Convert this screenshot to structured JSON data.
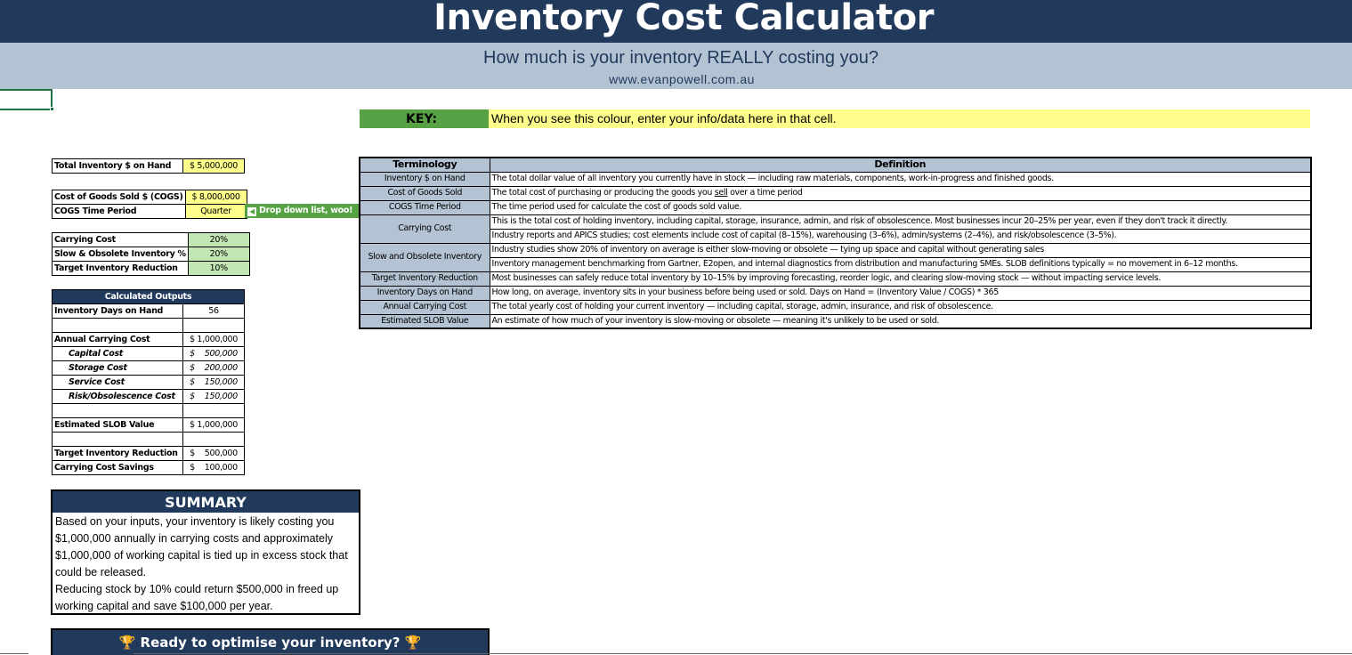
{
  "header": {
    "title": "Inventory Cost Calculator",
    "subtitle": "How much is your inventory REALLY costing you?",
    "website": "www.evanpowell.com.au"
  },
  "key": {
    "label": "KEY:",
    "text": "When you see this colour, enter your info/data here in that cell."
  },
  "inputs": {
    "total_inventory_label": "Total Inventory $ on Hand",
    "total_inventory_value": "$ 5,000,000",
    "cogs_label": "Cost of Goods Sold $ (COGS)",
    "cogs_value": "$ 8,000,000",
    "cogs_period_label": "COGS Time Period",
    "cogs_period_value": "Quarter",
    "dropdown_note": "Drop down list, woo!",
    "carrying_cost_label": "Carrying Cost",
    "carrying_cost_value": "20%",
    "slob_label": "Slow & Obsolete Inventory  %",
    "slob_value": "20%",
    "target_reduction_label": "Target Inventory Reduction",
    "target_reduction_value": "10%"
  },
  "outputs": {
    "heading": "Calculated Outputs",
    "days_label": "Inventory Days on Hand",
    "days_value": "56",
    "annual_label": "Annual Carrying Cost",
    "annual_value": "$ 1,000,000",
    "capital_label": "Capital Cost",
    "capital_value": "$    500,000",
    "storage_label": "Storage Cost",
    "storage_value": "$    200,000",
    "service_label": "Service Cost",
    "service_value": "$    150,000",
    "risk_label": "Risk/Obsolescence Cost",
    "risk_value": "$    150,000",
    "slob_est_label": "Estimated SLOB Value",
    "slob_est_value": "$ 1,000,000",
    "target_label": "Target Inventory Reduction",
    "target_value": "$    500,000",
    "savings_label": "Carrying Cost Savings",
    "savings_value": "$    100,000"
  },
  "terminology": {
    "col_term": "Terminology",
    "col_def": "Definition",
    "rows": [
      {
        "term": "Inventory $ on Hand",
        "def": "The total dollar value of all inventory you currently have in stock — including raw materials, components, work-in-progress and finished goods."
      },
      {
        "term": "Cost of Goods Sold",
        "def_a": "The total cost of purchasing or producing the goods you ",
        "def_b": "sell",
        "def_c": " over a time period"
      },
      {
        "term": "COGS Time Period",
        "def": "The time period used for calculate the cost of goods sold value."
      },
      {
        "term": "Carrying Cost",
        "def1": "This is the total cost of holding inventory, including capital, storage, insurance, admin, and risk of obsolescence. Most businesses incur 20–25% per year, even if they don't track it directly.",
        "def2": "Industry reports and APICS studies; cost elements include cost of capital (8–15%), warehousing (3–6%), admin/systems (2–4%), and risk/obsolescence (3–5%)."
      },
      {
        "term": "Slow and Obsolete Inventory",
        "def1": "Industry studies show 20% of inventory on average is either slow-moving or obsolete — tying up space and capital without generating sales",
        "def2": "Inventory management benchmarking from Gartner, E2open, and internal diagnostics from distribution and manufacturing SMEs. SLOB definitions typically = no movement in 6–12 months."
      },
      {
        "term": "Target Inventory Reduction",
        "def": "Most businesses can safely reduce total inventory by 10–15% by improving forecasting, reorder logic, and clearing slow-moving stock — without impacting service levels."
      },
      {
        "term": "Inventory Days on Hand",
        "def": "How long, on average, inventory sits in your business before being used or sold. Days on Hand = (Inventory Value / COGS) * 365"
      },
      {
        "term": "Annual Carrying Cost",
        "def": "The total yearly cost of holding your current inventory — including capital, storage, admin, insurance, and risk of obsolescence."
      },
      {
        "term": "Estimated SLOB Value",
        "def": "An estimate of how much of your inventory is slow-moving or obsolete — meaning it's unlikely to be used or sold."
      }
    ]
  },
  "summary": {
    "heading": "SUMMARY",
    "line1": "Based on your inputs, your inventory is likely costing you $1,000,000 annually in carrying costs and approximately $1,000,000 of working capital is tied up in excess stock that could be released.",
    "line2": "Reducing stock by 10% could return $500,000 in freed up working capital and save $100,000 per year."
  },
  "cta": {
    "text": "Ready to optimise your inventory?",
    "icon": "trophy-icon"
  },
  "colors": {
    "navy": "#213a5c",
    "light_blue": "#b3c3d3",
    "input_yellow": "#fefe8d",
    "input_green": "#c1e6b3",
    "key_green": "#57a245"
  }
}
